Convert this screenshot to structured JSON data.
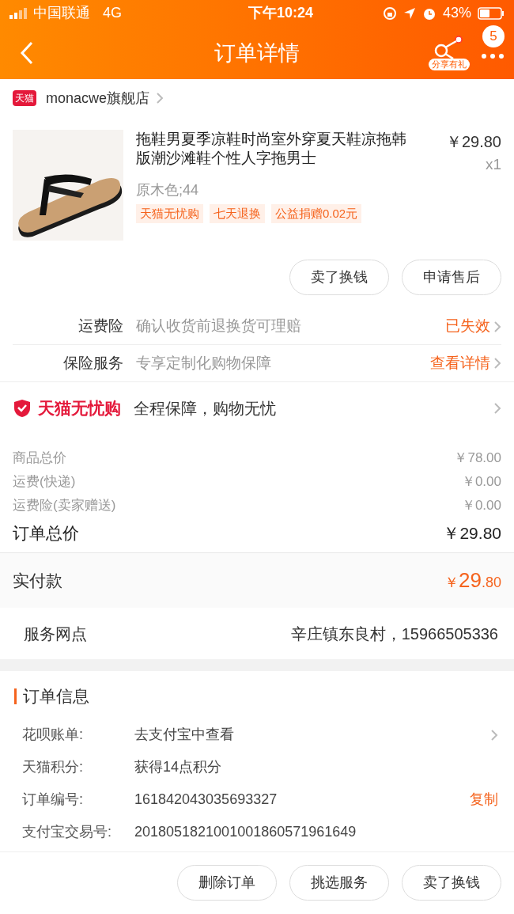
{
  "status_bar": {
    "carrier": "中国联通",
    "network": "4G",
    "time": "下午10:24",
    "battery": "43%"
  },
  "nav": {
    "title": "订单详情",
    "share_label": "分享有礼",
    "badge": "5"
  },
  "shop": {
    "badge": "天猫",
    "name": "monacwe旗舰店"
  },
  "product": {
    "title": "拖鞋男夏季凉鞋时尚室外穿夏天鞋凉拖韩版潮沙滩鞋个性人字拖男士",
    "price": "￥29.80",
    "quantity": "x1",
    "sku": "原木色;44",
    "tags": [
      "天猫无忧购",
      "七天退换",
      "公益捐赠0.02元"
    ]
  },
  "product_actions": [
    "卖了换钱",
    "申请售后"
  ],
  "services": [
    {
      "label": "运费险",
      "desc": "确认收货前退换货可理赔",
      "status": "已失效"
    },
    {
      "label": "保险服务",
      "desc": "专享定制化购物保障",
      "status": "查看详情"
    }
  ],
  "guarantee": {
    "brand": "天猫无忧购",
    "text": "全程保障，购物无忧"
  },
  "costs": [
    {
      "label": "商品总价",
      "value": "￥78.00",
      "kind": "minor"
    },
    {
      "label": "运费(快递)",
      "value": "￥0.00",
      "kind": "minor"
    },
    {
      "label": "运费险(卖家赠送)",
      "value": "￥0.00",
      "kind": "minor"
    },
    {
      "label": "订单总价",
      "value": "￥29.80",
      "kind": "total"
    }
  ],
  "paid": {
    "label": "实付款",
    "currency": "￥",
    "integer": "29",
    "decimal": ".80"
  },
  "service_point": {
    "label": "服务网点",
    "value": "辛庄镇东良村，15966505336"
  },
  "order_info": {
    "title": "订单信息",
    "rows": [
      {
        "label": "花呗账单:",
        "value": "去支付宝中查看",
        "kind": "link"
      },
      {
        "label": "天猫积分:",
        "value": "获得14点积分",
        "kind": "plain"
      },
      {
        "label": "订单编号:",
        "value": "161842043035693327",
        "kind": "copy",
        "action": "复制"
      },
      {
        "label": "支付宝交易号:",
        "value": "2018051821001001860571961649",
        "kind": "plain"
      }
    ]
  },
  "bottom_actions": [
    "删除订单",
    "挑选服务",
    "卖了换钱"
  ]
}
